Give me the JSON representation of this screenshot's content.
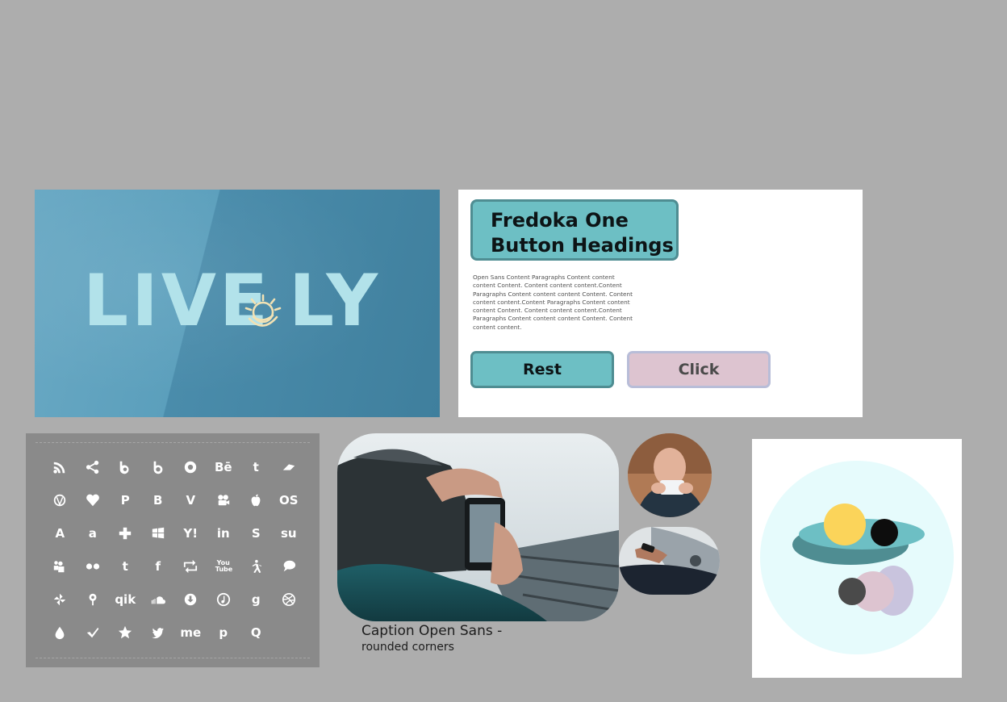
{
  "logo": {
    "text_left": "LIVE",
    "text_right": "LY",
    "colors": {
      "background_light": "#6aa9c4",
      "background_dark": "#3f7f9d",
      "letters": "#b2e2ea",
      "sun_icon": "#f2e2b4"
    }
  },
  "style_guide": {
    "heading_line_1": "Fredoka One",
    "heading_line_2": "Button Headings",
    "paragraph": "Open Sans Content Paragraphs Content content content Content. Content content content.Content Paragraphs Content content content Content. Content content content.Content Paragraphs Content content content Content. Content content content.Content Paragraphs Content content content Content. Content content content.",
    "button_rest_label": "Rest",
    "button_click_label": "Click",
    "colors": {
      "teal": "#6dbfc4",
      "teal_border": "#4f8d92",
      "pink": "#ddc4d0",
      "lavender_border": "#b8bdd8"
    }
  },
  "icons": {
    "row1": [
      "rss-icon",
      "share-icon",
      "bebo-icon",
      "blip-icon",
      "picasa-icon",
      "behance-icon",
      "tumblr-icon",
      "delicious-icon"
    ],
    "row1_glyphs": [
      "",
      "",
      "",
      "",
      "",
      "Bē",
      "t",
      ""
    ],
    "row2": [
      "wordpress-icon",
      "heart-icon",
      "paypal-icon",
      "blogger-icon",
      "vimeo-icon",
      "video-camera-icon",
      "apple-icon",
      "lastfm-icon"
    ],
    "row2_glyphs": [
      "",
      "",
      "P",
      "B",
      "V",
      "",
      "",
      "OS"
    ],
    "row3": [
      "appstore-icon",
      "amazon-icon",
      "plus-icon",
      "windows-icon",
      "yahoo-icon",
      "linkedin-icon",
      "skype-icon",
      "stumbleupon-icon"
    ],
    "row3_glyphs": [
      "A",
      "a",
      "",
      "",
      "Y!",
      "in",
      "S",
      "su"
    ],
    "row4": [
      "myspace-icon",
      "flickr-icon",
      "twitter-t-icon",
      "facebook-icon",
      "retweet-icon",
      "youtube-icon",
      "person-icon",
      "chat-bubble-icon"
    ],
    "row4_glyphs": [
      "",
      "",
      "t",
      "f",
      "",
      "You Tube",
      "",
      ""
    ],
    "row5": [
      "pinwheel-icon",
      "pin-marker-icon",
      "qik-icon",
      "soundcloud-icon",
      "download-icon",
      "music-circle-icon",
      "google-icon",
      "dribbble-icon"
    ],
    "row5_glyphs": [
      "",
      "",
      "qik",
      "",
      "",
      "",
      "g",
      ""
    ],
    "row6": [
      "drop-icon",
      "checkmark-icon",
      "star-icon",
      "twitter-bird-icon",
      "aboutme-icon",
      "pinterest-icon",
      "quora-icon"
    ],
    "row6_glyphs": [
      "",
      "",
      "",
      "",
      "me",
      "p",
      "Q"
    ]
  },
  "caption": {
    "title": "Caption Open Sans -",
    "subtitle": "rounded corners"
  },
  "illustration": {
    "colors": {
      "circle": "#e6fbfc",
      "teal_ellipse": "#6dbfc4",
      "dark_teal": "#4f8d92",
      "yellow": "#fbd45a",
      "black": "#0d0d0d",
      "pink": "#ddc4d0",
      "lavender": "#c9c4de",
      "gray": "#4a4a4a"
    }
  }
}
